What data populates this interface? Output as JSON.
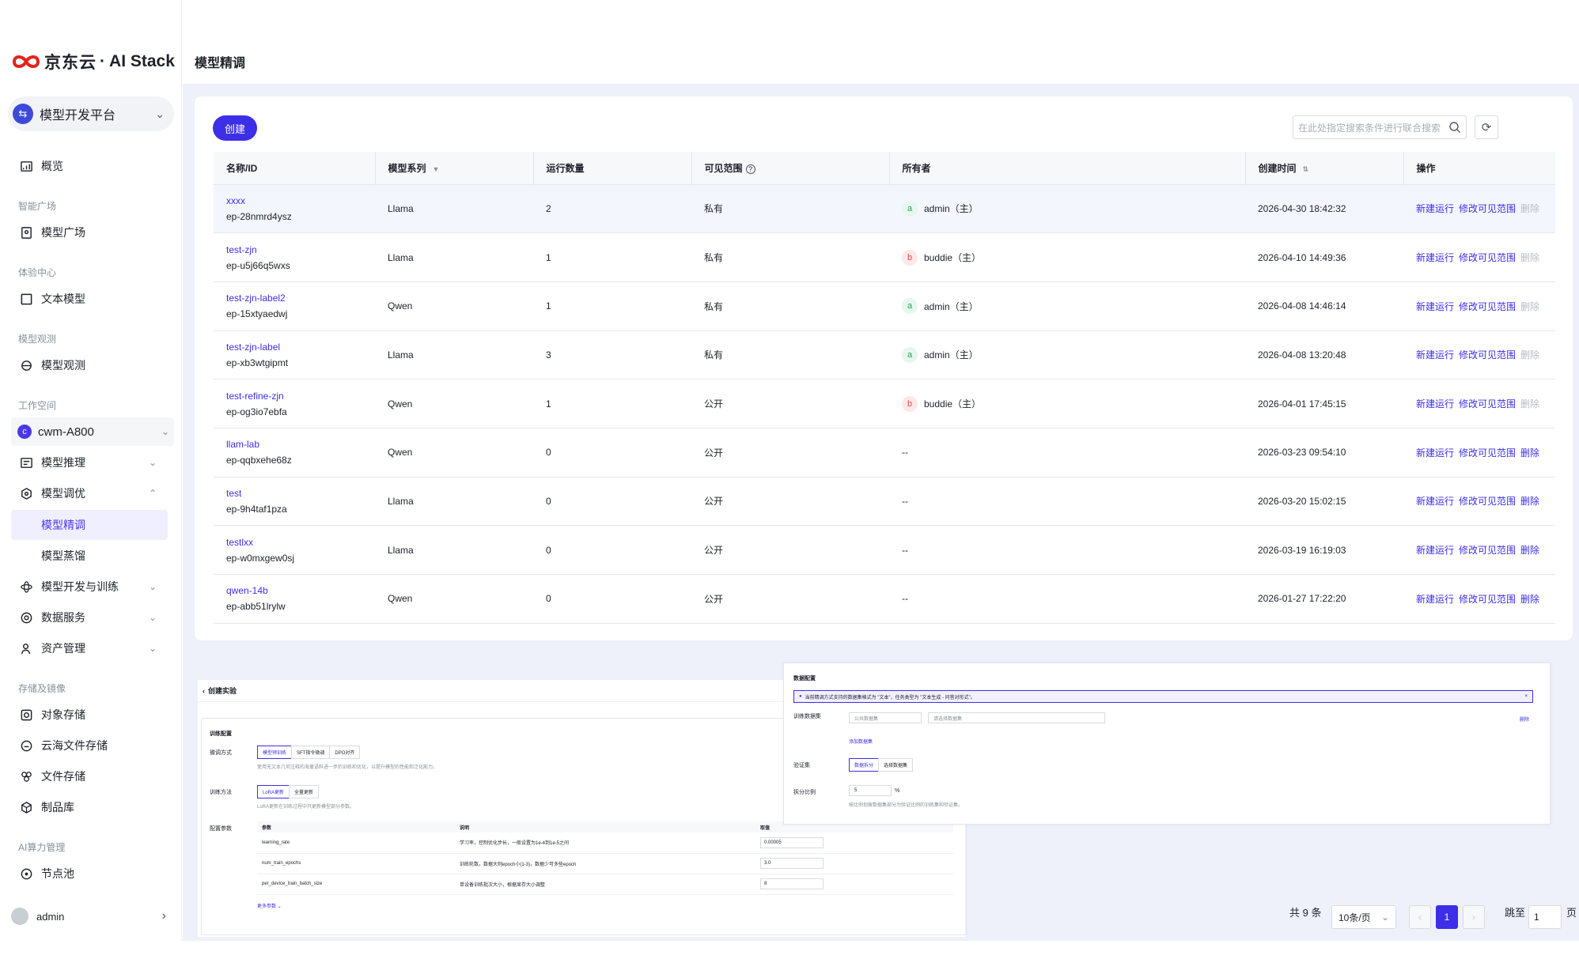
{
  "brand": {
    "logo_cn": "京东云",
    "logo_en": "· AI Stack",
    "color": "#e1251b"
  },
  "platform": {
    "label": "模型开发平台"
  },
  "nav": {
    "overview": "概览",
    "section_smart": "智能广场",
    "model_plaza": "模型广场",
    "section_exp": "体验中心",
    "text_model": "文本模型",
    "section_obs": "模型观测",
    "model_obs": "模型观测",
    "section_ws": "工作空间",
    "workspace": "cwm-A800",
    "workspace_badge": "c",
    "model_infer": "模型推理",
    "model_tune": "模型调优",
    "fine_tune": "模型精调",
    "distill": "模型蒸馏",
    "dev_train": "模型开发与训练",
    "data_service": "数据服务",
    "asset_mgmt": "资产管理",
    "section_storage": "存储及镜像",
    "object_storage": "对象存储",
    "cloud_file": "云海文件存储",
    "file_storage": "文件存储",
    "artifact_repo": "制品库",
    "section_compute": "AI算力管理",
    "node_pool": "节点池",
    "user": "admin"
  },
  "page": {
    "title": "模型精调"
  },
  "toolbar": {
    "create_label": "创建",
    "search_placeholder": "在此处指定搜索条件进行联合搜索"
  },
  "table": {
    "headers": [
      "名称/ID",
      "模型系列",
      "运行数量",
      "可见范围",
      "所有者",
      "创建时间",
      "操作"
    ],
    "ops": [
      "新建运行",
      "修改可见范围",
      "删除"
    ],
    "rows": [
      {
        "name": "xxxx",
        "id": "ep-28nmrd4ysz",
        "series": "Llama",
        "runs": "2",
        "scope": "私有",
        "owner_badge": "a",
        "owner": "admin（主）",
        "created": "2026-04-30 18:42:32",
        "del_enabled": false
      },
      {
        "name": "test-zjn",
        "id": "ep-u5j66q5wxs",
        "series": "Llama",
        "runs": "1",
        "scope": "私有",
        "owner_badge": "b",
        "owner": "buddie（主）",
        "created": "2026-04-10 14:49:36",
        "del_enabled": false
      },
      {
        "name": "test-zjn-label2",
        "id": "ep-15xtyaedwj",
        "series": "Qwen",
        "runs": "1",
        "scope": "私有",
        "owner_badge": "a",
        "owner": "admin（主）",
        "created": "2026-04-08 14:46:14",
        "del_enabled": false
      },
      {
        "name": "test-zjn-label",
        "id": "ep-xb3wtgipmt",
        "series": "Llama",
        "runs": "3",
        "scope": "私有",
        "owner_badge": "a",
        "owner": "admin（主）",
        "created": "2026-04-08 13:20:48",
        "del_enabled": false
      },
      {
        "name": "test-refine-zjn",
        "id": "ep-og3io7ebfa",
        "series": "Qwen",
        "runs": "1",
        "scope": "公开",
        "owner_badge": "b",
        "owner": "buddie（主）",
        "created": "2026-04-01 17:45:15",
        "del_enabled": false
      },
      {
        "name": "llam-lab",
        "id": "ep-qqbxehe68z",
        "series": "Qwen",
        "runs": "0",
        "scope": "公开",
        "owner_badge": "",
        "owner": "--",
        "created": "2026-03-23 09:54:10",
        "del_enabled": true
      },
      {
        "name": "test",
        "id": "ep-9h4taf1pza",
        "series": "Llama",
        "runs": "0",
        "scope": "公开",
        "owner_badge": "",
        "owner": "--",
        "created": "2026-03-20 15:02:15",
        "del_enabled": true
      },
      {
        "name": "testlxx",
        "id": "ep-w0mxgew0sj",
        "series": "Llama",
        "runs": "0",
        "scope": "公开",
        "owner_badge": "",
        "owner": "--",
        "created": "2026-03-19 16:19:03",
        "del_enabled": true
      },
      {
        "name": "qwen-14b",
        "id": "ep-abb51lrylw",
        "series": "Qwen",
        "runs": "0",
        "scope": "公开",
        "owner_badge": "",
        "owner": "--",
        "created": "2026-01-27 17:22:20",
        "del_enabled": true
      }
    ]
  },
  "pagination": {
    "total": "共 9 条",
    "page_size": "10条/页",
    "current": "1",
    "jump_label": "跳至",
    "jump_value": "1",
    "page_suffix": "页"
  },
  "create_experiment": {
    "title": "创建实验",
    "section": "训练配置",
    "method_label": "微调方式",
    "methods": [
      "模型预训练",
      "SFT指令微调",
      "DPO对齐"
    ],
    "method_hint": "使用无文本几何注释的海量语料进一步的训练和优化，以提升模型的性能和泛化能力。",
    "train_label": "训练方法",
    "train_methods": [
      "LoRA更新",
      "全量更新"
    ],
    "train_hint": "LoRA更新在训练过程中只更新模型部分参数。",
    "params_label": "配置参数",
    "param_headers": [
      "参数",
      "说明",
      "取值"
    ],
    "params": [
      {
        "name": "learning_rate",
        "desc": "学习率，控制优化步长，一般设置为1e-4到1e-5之间",
        "value": "0.00005"
      },
      {
        "name": "num_train_epochs",
        "desc": "训练轮数，数据大则epoch小(1-3)，数据少可多些epoch",
        "value": "3.0"
      },
      {
        "name": "per_device_train_batch_size",
        "desc": "单设备训练批次大小，根据显存大小调整",
        "value": "8"
      }
    ],
    "more": "更多参数 ⌄"
  },
  "data_config": {
    "title": "数据配置",
    "alert": "当前精调方式支持的数据集格式为 \"文本\"，任务类型为 \"文本生成 - 问答对形式\"。",
    "dataset_label": "训练数据集",
    "dataset_type": "公共数据集",
    "dataset_placeholder": "请选择数据集",
    "delete": "删除",
    "add_dataset": "添加数据集",
    "val_label": "验证集",
    "val_options": [
      "数据拆分",
      "选择数据集"
    ],
    "split_label": "拆分比例",
    "split_value": "5",
    "split_unit": "%",
    "split_hint": "按比例划拨数据集部分为验证比例的训练集和验证集。"
  }
}
